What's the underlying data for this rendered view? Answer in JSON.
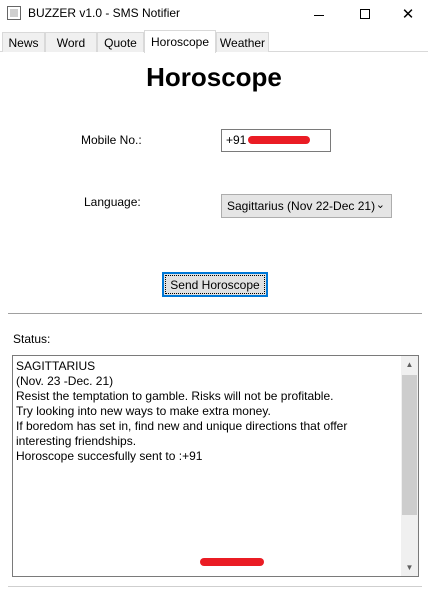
{
  "window": {
    "title": "BUZZER v1.0 - SMS Notifier",
    "minimize_glyph": "",
    "close_glyph": "✕"
  },
  "tabs": [
    {
      "label": "News",
      "active": false
    },
    {
      "label": "Word",
      "active": false
    },
    {
      "label": "Quote",
      "active": false
    },
    {
      "label": "Horoscope",
      "active": true
    },
    {
      "label": "Weather",
      "active": false
    }
  ],
  "page": {
    "title": "Horoscope"
  },
  "form": {
    "mobile_label": "Mobile No.:",
    "mobile_value": "+91",
    "language_label": "Language:",
    "language_selected": "Sagittarius (Nov 22-Dec 21)",
    "send_button": "Send Horoscope"
  },
  "status": {
    "label": "Status:",
    "lines": [
      "SAGITTARIUS",
      "",
      "(Nov. 23 -Dec. 21)",
      "",
      "",
      "",
      "Resist the temptation to gamble. Risks will not be profitable.",
      "Try looking into new ways to make extra money.",
      "If boredom has set in, find new and unique directions that offer",
      "interesting friendships.",
      "",
      "",
      "",
      "Horoscope succesfully sent to :+91"
    ]
  },
  "colors": {
    "accent": "#0078d7",
    "redaction": "#ea1c24"
  }
}
